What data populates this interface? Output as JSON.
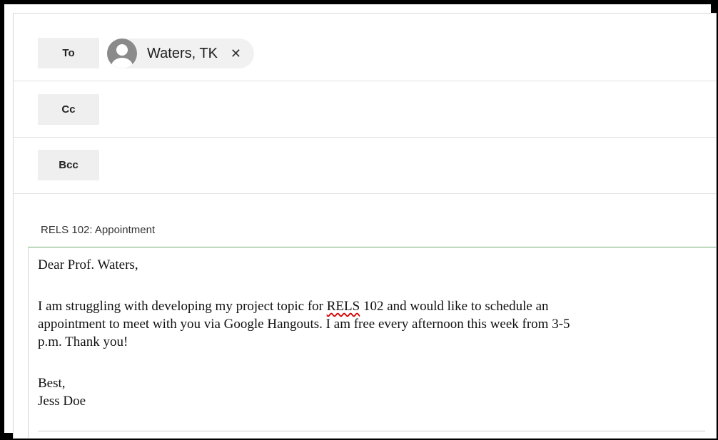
{
  "recipients": {
    "to_label": "To",
    "cc_label": "Cc",
    "bcc_label": "Bcc",
    "to_chip": {
      "name": "Waters, TK",
      "remove_glyph": "✕",
      "avatar_icon": "person-icon"
    }
  },
  "subject": "RELS 102: Appointment",
  "body": {
    "greeting": "Dear Prof. Waters,",
    "paragraph_lines": [
      {
        "before": "I am struggling with developing my project topic for ",
        "flagged": "RELS",
        "after": " 102 and would like to schedule an"
      },
      "appointment to meet with you via Google Hangouts. I am free every afternoon this week from 3-5",
      "p.m. Thank you!"
    ],
    "closing": "Best,",
    "signature": "Jess Doe"
  },
  "colors": {
    "frame": "#000000",
    "field_button_bg": "#efefef",
    "chip_bg": "#f1f1f1",
    "spellcheck_underline": "#d40000",
    "body_focus_border": "#6aa86a"
  }
}
